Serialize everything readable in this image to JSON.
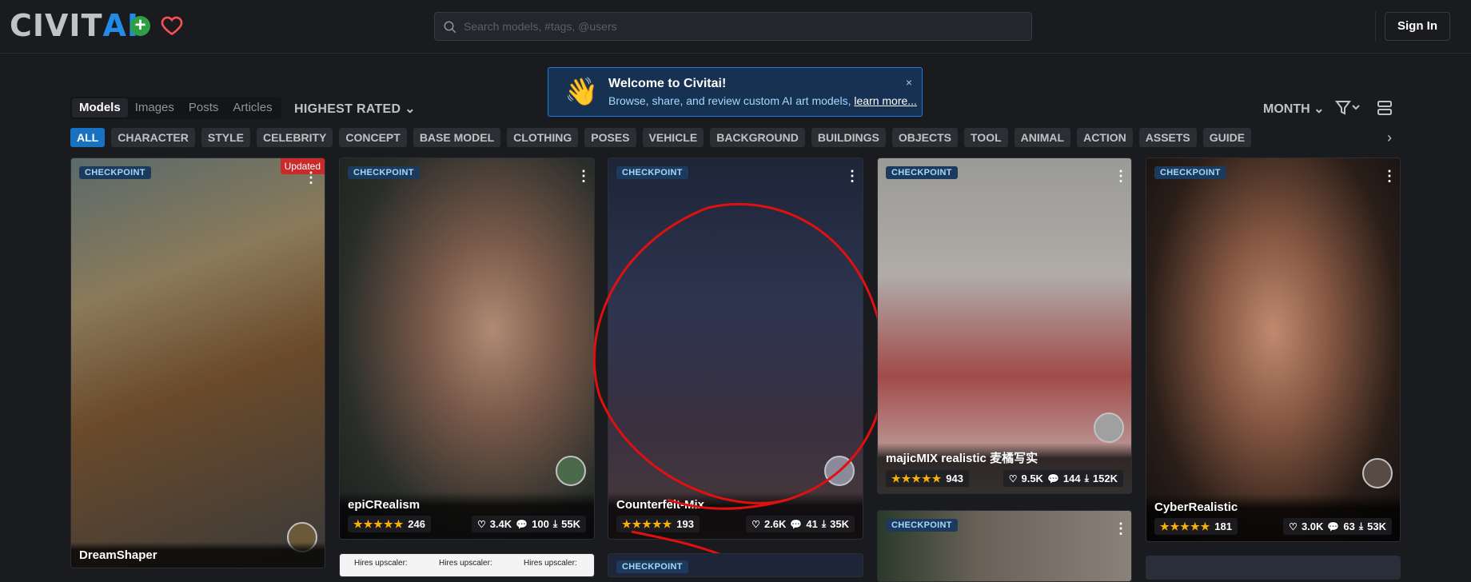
{
  "header": {
    "logo_part1": "CIVIT",
    "logo_part2": "AI",
    "search_placeholder": "Search models, #tags, @users",
    "signin_label": "Sign In"
  },
  "welcome": {
    "title": "Welcome to Civitai!",
    "text": "Browse, share, and review custom AI art models,",
    "link": "learn more...",
    "close": "×"
  },
  "nav": {
    "segments": [
      "Models",
      "Images",
      "Posts",
      "Articles"
    ],
    "sort": "HIGHEST RATED",
    "period": "MONTH"
  },
  "tags": [
    "ALL",
    "CHARACTER",
    "STYLE",
    "CELEBRITY",
    "CONCEPT",
    "BASE MODEL",
    "CLOTHING",
    "POSES",
    "VEHICLE",
    "BACKGROUND",
    "BUILDINGS",
    "OBJECTS",
    "TOOL",
    "ANIMAL",
    "ACTION",
    "ASSETS",
    "GUIDE"
  ],
  "cards": [
    {
      "badge": "CHECKPOINT",
      "updated": "Updated",
      "name": "DreamShaper",
      "rating": "",
      "likes": "",
      "comments": "",
      "downloads": ""
    },
    {
      "badge": "CHECKPOINT",
      "name": "epiCRealism",
      "rating": "246",
      "likes": "3.4K",
      "comments": "100",
      "downloads": "55K"
    },
    {
      "badge": "CHECKPOINT",
      "name": "Counterfeit-Mix",
      "rating": "193",
      "likes": "2.6K",
      "comments": "41",
      "downloads": "35K"
    },
    {
      "badge": "CHECKPOINT",
      "name": "majicMIX realistic 麦橘写实",
      "rating": "943",
      "likes": "9.5K",
      "comments": "144",
      "downloads": "152K"
    },
    {
      "badge": "CHECKPOINT",
      "name": "CyberRealistic",
      "rating": "181",
      "likes": "3.0K",
      "comments": "63",
      "downloads": "53K"
    },
    {
      "badge": "CHECKPOINT"
    },
    {
      "badge": "CHECKPOINT",
      "upscaler1": "Hires upscaler:",
      "upscaler2": "Hires upscaler:",
      "upscaler3": "Hires upscaler:"
    },
    {
      "badge": "CHECKPOINT"
    }
  ],
  "stars": "★★★★★"
}
